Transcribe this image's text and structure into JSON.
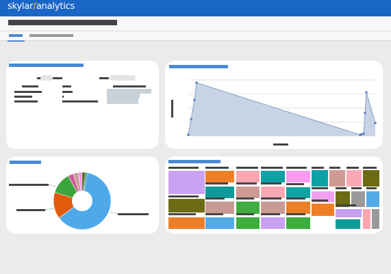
{
  "app": {
    "brand_left": "skylar",
    "brand_right": "analytics"
  },
  "colors": {
    "topbar": "#1a66c6",
    "accent": "#4a89d4",
    "brand_slash": "#f2a23a"
  },
  "chart_data": [
    {
      "type": "area",
      "x": [
        0,
        1,
        2,
        3,
        4,
        5,
        6,
        7,
        8,
        9
      ],
      "y": [
        0.02,
        0.3,
        0.64,
        0.95,
        0.02,
        0.03,
        0.04,
        0.41,
        0.78,
        0.23
      ],
      "ylim": [
        0,
        1
      ],
      "grid": true
    },
    {
      "type": "pie",
      "values": [
        62,
        15,
        12,
        3,
        3,
        2,
        2,
        1
      ],
      "colors": [
        "#4fa9e8",
        "#e05b0c",
        "#3ca43c",
        "#d05a9a",
        "#c99f9a",
        "#f093d9",
        "#5b6e26",
        "#1e8a6e"
      ],
      "donut": true
    },
    {
      "type": "treemap",
      "values": [
        14,
        10,
        8,
        8,
        7,
        7,
        6,
        6,
        5,
        5,
        5,
        5,
        4,
        4,
        4,
        3,
        3,
        3,
        3,
        3,
        3,
        2,
        2,
        2,
        2,
        2,
        2,
        2
      ],
      "colors": [
        "#c9a3f2",
        "#ed7f27",
        "#fba6b0",
        "#0aa2a5",
        "#f79cf0",
        "#0e9a9a",
        "#cf9a94",
        "#f9a8b4",
        "#6b6b13",
        "#c99a94",
        "#3fae3f",
        "#c99a94",
        "#0fa4a3",
        "#ed7f27",
        "#f2a1f0",
        "#6a6b13",
        "#999999",
        "#52aae6",
        "#ee7f27",
        "#52aae6",
        "#3cae3c",
        "#c8a0f2",
        "#3cae3c",
        "#ee7f27",
        "#c8a0f2",
        "#0f9a9a",
        "#fba6b0",
        "#999999"
      ]
    }
  ]
}
